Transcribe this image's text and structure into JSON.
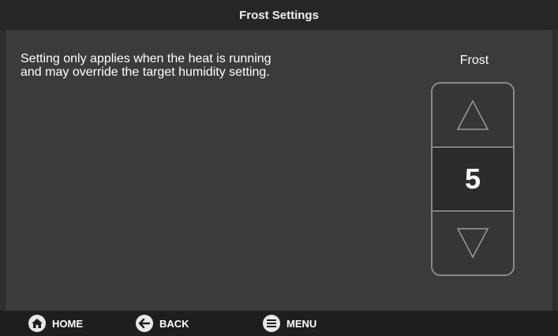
{
  "header": {
    "title": "Frost Settings"
  },
  "main": {
    "description": "Setting only applies when the heat is running and may override the target humidity setting.",
    "control": {
      "label": "Frost",
      "value": "5"
    }
  },
  "footer": {
    "nav": [
      {
        "label": "HOME",
        "icon": "home-icon"
      },
      {
        "label": "BACK",
        "icon": "arrow-left-icon"
      },
      {
        "label": "MENU",
        "icon": "menu-icon"
      }
    ]
  },
  "colors": {
    "title_bar": "#262626",
    "background": "#3b3b3b",
    "footer": "#1e1e1e",
    "stepper_border": "#8a8a8a",
    "text": "#ffffff"
  }
}
